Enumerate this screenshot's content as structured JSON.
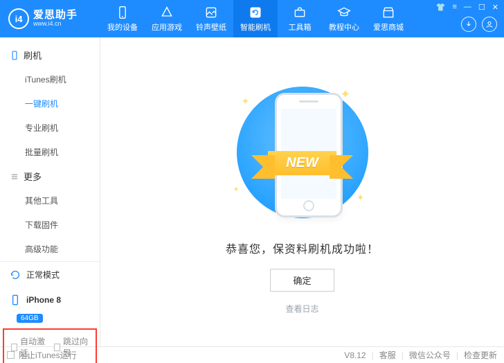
{
  "header": {
    "logo_title": "爱思助手",
    "logo_sub": "www.i4.cn",
    "logo_mark": "i4",
    "tabs": [
      {
        "label": "我的设备"
      },
      {
        "label": "应用游戏"
      },
      {
        "label": "铃声壁纸"
      },
      {
        "label": "智能刷机"
      },
      {
        "label": "工具箱"
      },
      {
        "label": "教程中心"
      },
      {
        "label": "爱思商城"
      }
    ]
  },
  "sidebar": {
    "section1_title": "刷机",
    "section1_items": [
      "iTunes刷机",
      "一键刷机",
      "专业刷机",
      "批量刷机"
    ],
    "section2_title": "更多",
    "section2_items": [
      "其他工具",
      "下载固件",
      "高级功能"
    ],
    "mode_label": "正常模式",
    "device_name": "iPhone 8",
    "device_badge": "64GB",
    "cb_auto_activate": "自动激活",
    "cb_skip_guide": "跳过向导"
  },
  "main": {
    "ribbon_text": "NEW",
    "congrats_text": "恭喜您，保资料刷机成功啦！",
    "ok_button": "确定",
    "log_link": "查看日志"
  },
  "footer": {
    "block_itunes": "阻止iTunes运行",
    "version": "V8.12",
    "support": "客服",
    "wechat": "微信公众号",
    "update": "检查更新"
  }
}
